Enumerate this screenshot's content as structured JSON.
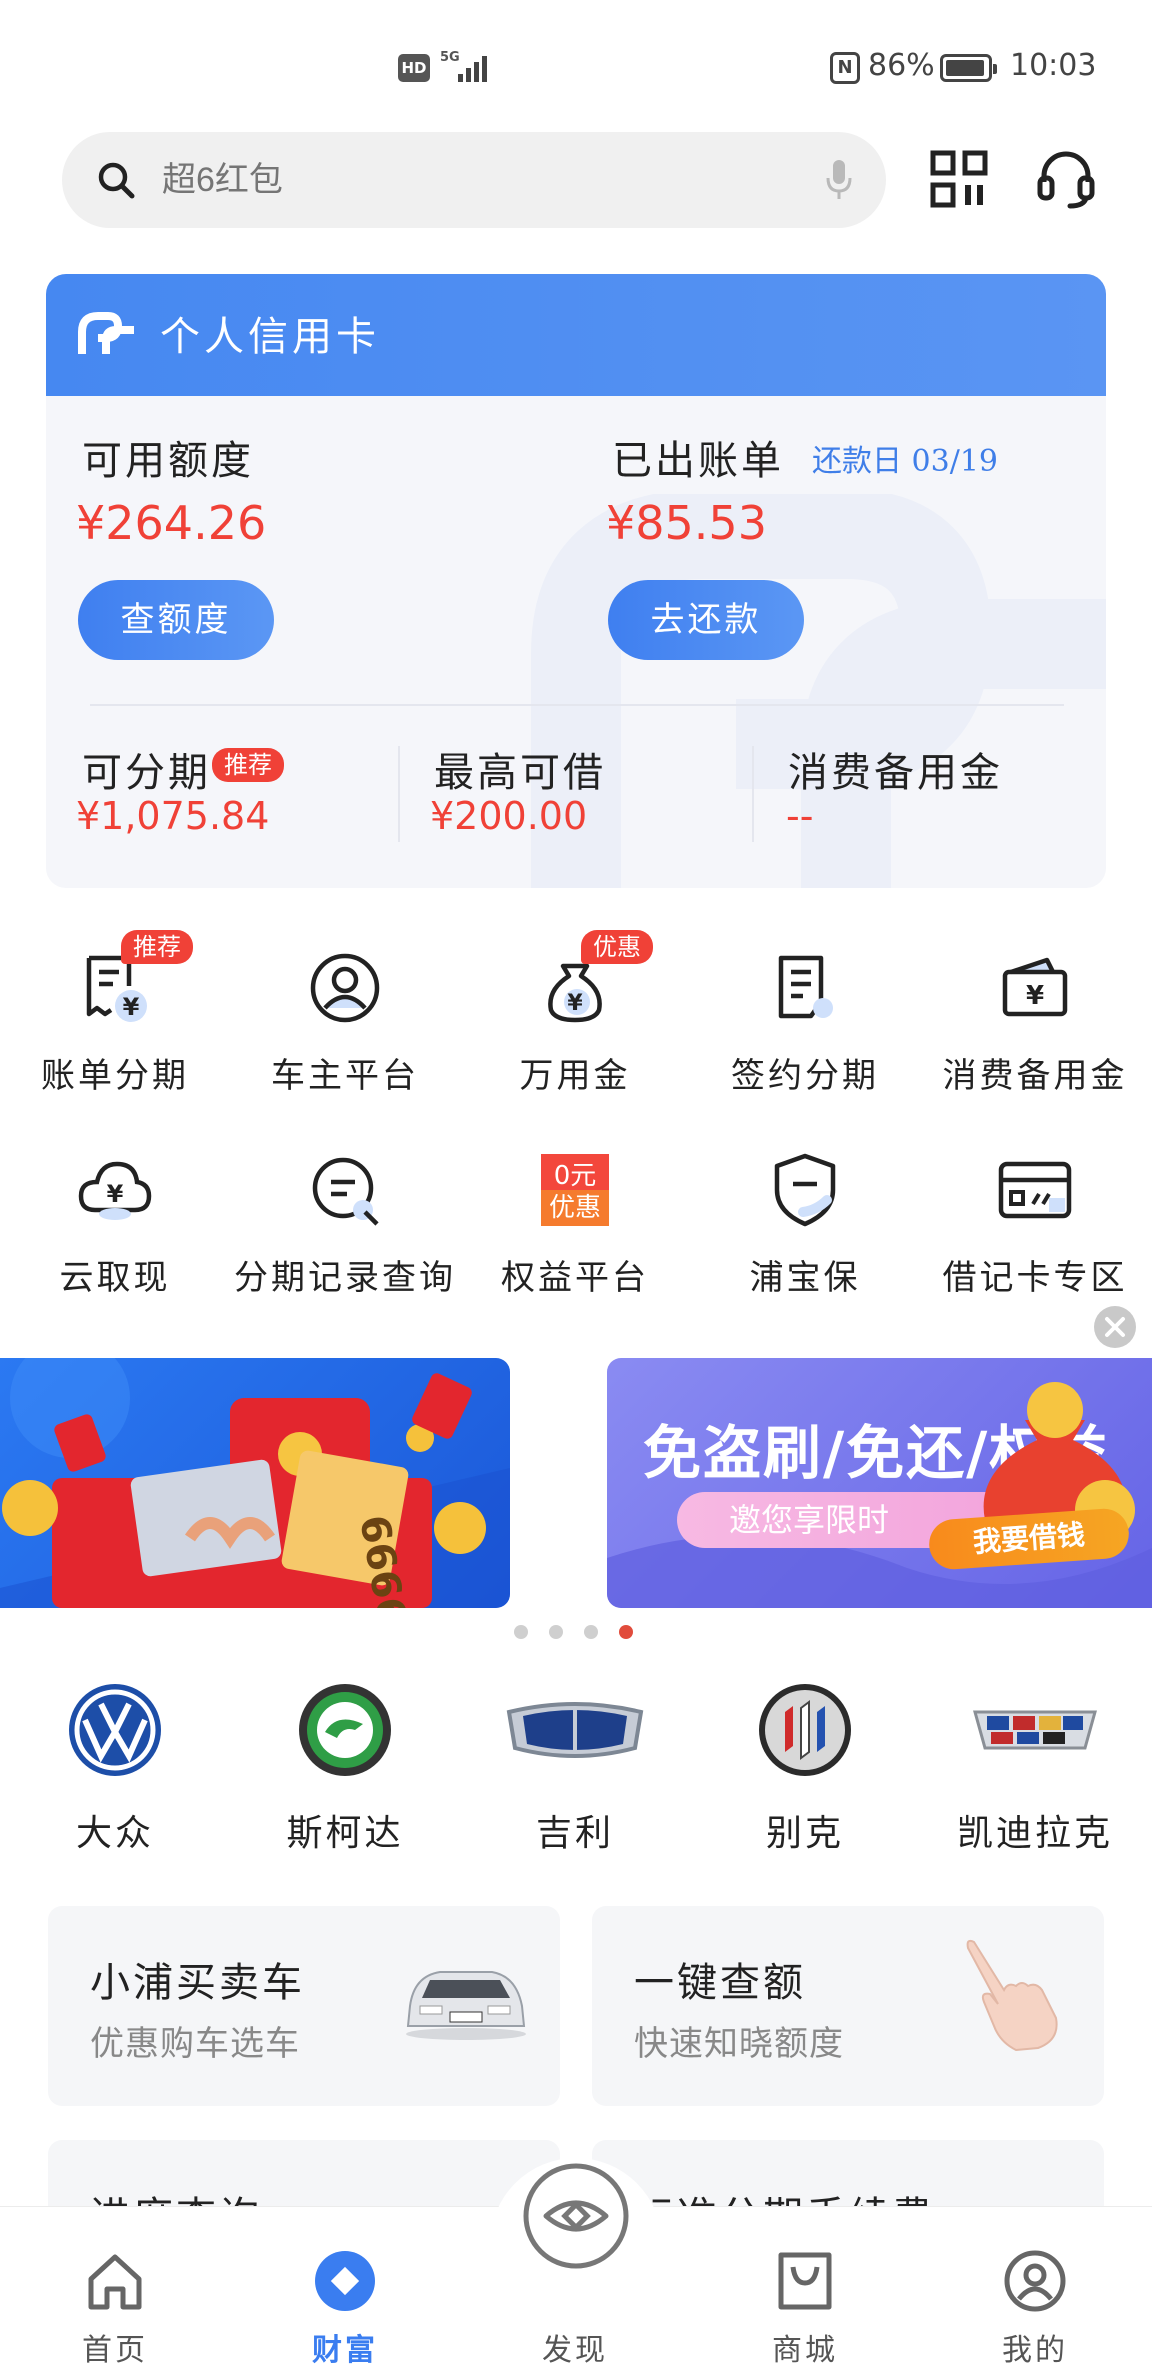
{
  "status_bar": {
    "hd": "HD",
    "network": "5G",
    "battery": "86%",
    "time": "10:03"
  },
  "search": {
    "placeholder": "超6红包"
  },
  "credit_card": {
    "title": "个人信用卡",
    "available_label": "可用额度",
    "available_amount": "¥264.26",
    "check_limit_button": "查额度",
    "billed_label": "已出账单",
    "due_label": "还款日 03/19",
    "billed_amount": "¥85.53",
    "repay_button": "去还款",
    "installment_label": "可分期",
    "installment_tag": "推荐",
    "installment_amount": "¥1,075.84",
    "max_borrow_label": "最高可借",
    "max_borrow_amount": "¥200.00",
    "reserve_label": "消费备用金",
    "reserve_amount": "--"
  },
  "services": [
    {
      "label": "账单分期",
      "tag": "推荐",
      "icon": "bill-installment-icon"
    },
    {
      "label": "车主平台",
      "tag": "",
      "icon": "car-owner-icon"
    },
    {
      "label": "万用金",
      "tag": "优惠",
      "icon": "money-bag-icon"
    },
    {
      "label": "签约分期",
      "tag": "",
      "icon": "contract-icon"
    },
    {
      "label": "消费备用金",
      "tag": "",
      "icon": "wallet-icon"
    },
    {
      "label": "云取现",
      "tag": "",
      "icon": "cloud-cash-icon"
    },
    {
      "label": "分期记录查询",
      "tag": "",
      "icon": "record-search-icon"
    },
    {
      "label": "权益平台",
      "tag": "",
      "icon": "coupon-icon"
    },
    {
      "label": "浦宝保",
      "tag": "",
      "icon": "shield-icon"
    },
    {
      "label": "借记卡专区",
      "tag": "",
      "icon": "debit-card-icon"
    }
  ],
  "coupon_badge": {
    "line1": "0元",
    "line2": "优惠"
  },
  "banners": {
    "left_card_text": "6666",
    "right_headline": "免盗刷/免还/权益",
    "right_sub": "邀您享限时",
    "right_cta": "我要借钱",
    "active_index": 3,
    "count": 4
  },
  "car_brands": [
    {
      "label": "大众",
      "icon": "volkswagen-logo-icon"
    },
    {
      "label": "斯柯达",
      "icon": "skoda-logo-icon"
    },
    {
      "label": "吉利",
      "icon": "geely-logo-icon"
    },
    {
      "label": "别克",
      "icon": "buick-logo-icon"
    },
    {
      "label": "凯迪拉克",
      "icon": "cadillac-logo-icon"
    }
  ],
  "promos": [
    {
      "title": "小浦买卖车",
      "subtitle": "优惠购车选车"
    },
    {
      "title": "一键查额",
      "subtitle": "快速知晓额度"
    },
    {
      "title": "进度查询",
      "subtitle": ""
    },
    {
      "title": "标准分期手续费",
      "subtitle": ""
    }
  ],
  "tabs": [
    {
      "label": "首页",
      "icon": "home-icon",
      "active": false
    },
    {
      "label": "财富",
      "icon": "wealth-icon",
      "active": true
    },
    {
      "label": "发现",
      "icon": "discover-eye-icon",
      "active": false
    },
    {
      "label": "商城",
      "icon": "shopping-bag-icon",
      "active": false
    },
    {
      "label": "我的",
      "icon": "profile-icon",
      "active": false
    }
  ],
  "colors": {
    "accent_blue": "#3a7df0",
    "amount_red": "#f04137"
  }
}
